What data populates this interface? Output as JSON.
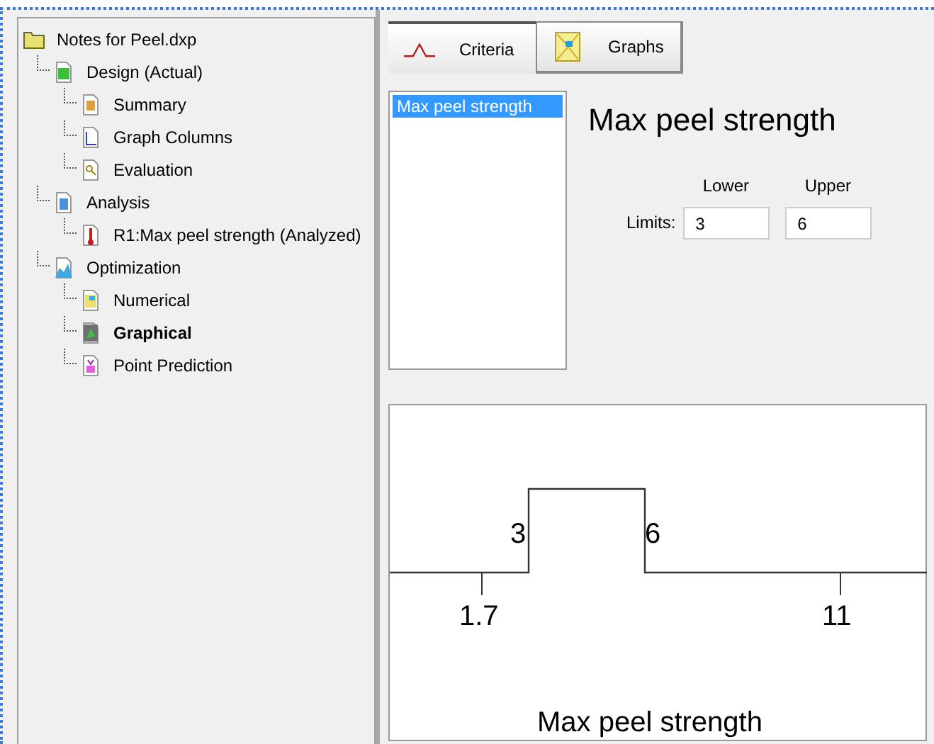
{
  "tree": {
    "label": "Notes for Peel.dxp",
    "kind": "folder",
    "selected": false,
    "children": [
      {
        "label": "Design (Actual)",
        "kind": "design",
        "selected": false,
        "children": [
          {
            "label": "Summary",
            "kind": "summary",
            "selected": false
          },
          {
            "label": "Graph Columns",
            "kind": "graph",
            "selected": false
          },
          {
            "label": "Evaluation",
            "kind": "evaluation",
            "selected": false
          }
        ]
      },
      {
        "label": "Analysis",
        "kind": "analysis",
        "selected": false,
        "children": [
          {
            "label": "R1:Max peel strength (Analyzed)",
            "kind": "response",
            "selected": false
          }
        ]
      },
      {
        "label": "Optimization",
        "kind": "optimization",
        "selected": false,
        "children": [
          {
            "label": "Numerical",
            "kind": "numerical",
            "selected": false
          },
          {
            "label": "Graphical",
            "kind": "graphical",
            "selected": true
          },
          {
            "label": "Point Prediction",
            "kind": "prediction",
            "selected": false
          }
        ]
      }
    ]
  },
  "tabs": [
    {
      "label": "Criteria",
      "kind": "criteria",
      "selected": true
    },
    {
      "label": "Graphs",
      "kind": "graphs",
      "selected": false
    }
  ],
  "responses": [
    {
      "label": "Max peel strength",
      "selected": true
    }
  ],
  "criteria": {
    "title": "Max peel strength",
    "limits_label": "Limits:",
    "lower": {
      "heading": "Lower",
      "value": "3"
    },
    "upper": {
      "heading": "Upper",
      "value": "6"
    }
  },
  "plot": {
    "min_label": "1.7",
    "max_label": "11",
    "lower_label": "3",
    "upper_label": "6",
    "axis_title": "Max peel strength"
  }
}
